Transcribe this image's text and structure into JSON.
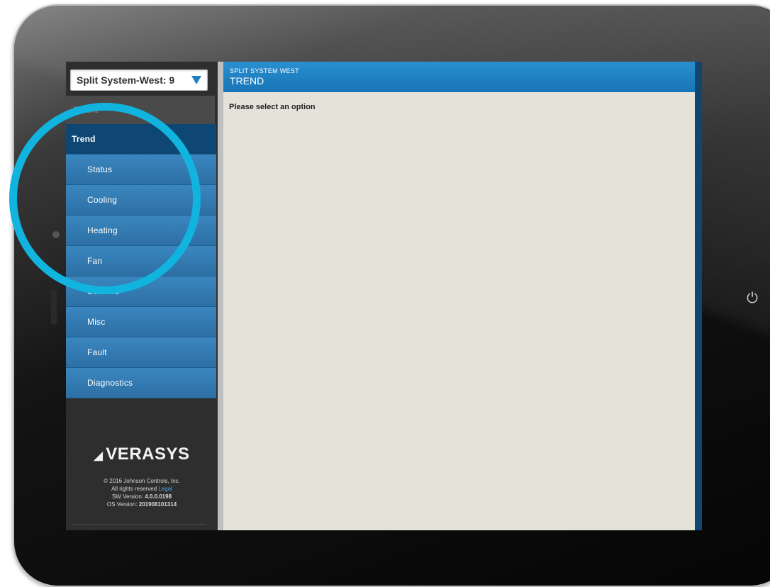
{
  "system_selector": {
    "value": "Split System-West: 9"
  },
  "sidebar": {
    "parent_label": "Parent",
    "items": [
      {
        "label": "Trend",
        "active": true
      },
      {
        "label": "Status",
        "active": false
      },
      {
        "label": "Cooling",
        "active": false
      },
      {
        "label": "Heating",
        "active": false
      },
      {
        "label": "Fan",
        "active": false
      },
      {
        "label": "Sensors",
        "active": false
      },
      {
        "label": "Misc",
        "active": false
      },
      {
        "label": "Fault",
        "active": false
      },
      {
        "label": "Diagnostics",
        "active": false
      }
    ]
  },
  "brand": {
    "name": "VERASYS",
    "copyright": "© 2016 Johnson Controls, Inc.",
    "rights": "All rights reserved",
    "legal_link": "Legal",
    "sw_version_label": "SW Version:",
    "sw_version": "4.0.0.0198",
    "os_version_label": "OS Version:",
    "os_version": "201908101314"
  },
  "main": {
    "header_sub": "SPLIT SYSTEM WEST",
    "header_title": "TREND",
    "prompt": "Please select an option"
  },
  "colors": {
    "accent": "#1f7fc0",
    "menu": "#2c6fa4",
    "menu_active": "#0e4774",
    "content_bg": "#e5e3d9",
    "highlight_ring": "#10b4de"
  }
}
